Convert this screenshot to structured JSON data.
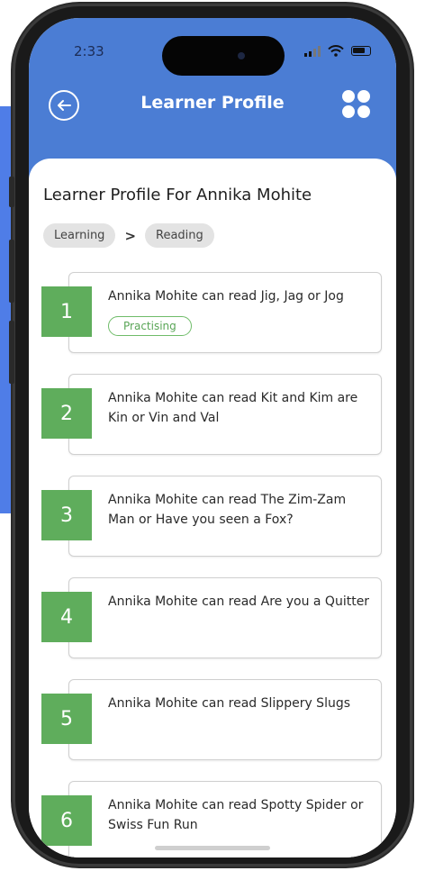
{
  "status_bar": {
    "time": "2:33"
  },
  "header": {
    "title": "Learner Profile"
  },
  "page": {
    "title": "Learner Profile For Annika Mohite",
    "breadcrumb": [
      "Learning",
      "Reading"
    ]
  },
  "items": [
    {
      "number": "1",
      "text": "Annika Mohite can read Jig, Jag or Jog",
      "status": "Practising"
    },
    {
      "number": "2",
      "text": "Annika Mohite can read Kit and Kim are Kin or Vin and Val"
    },
    {
      "number": "3",
      "text": "Annika Mohite can read The Zim-Zam Man or Have you seen a Fox?"
    },
    {
      "number": "4",
      "text": "Annika Mohite can read Are you a Quitter"
    },
    {
      "number": "5",
      "text": "Annika Mohite can read Slippery Slugs"
    },
    {
      "number": "6",
      "text": "Annika Mohite can read Spotty Spider or Swiss Fun Run"
    }
  ],
  "colors": {
    "header": "#4b7dd4",
    "number_tile": "#5fad5c",
    "status_outline": "#6fbc69"
  }
}
